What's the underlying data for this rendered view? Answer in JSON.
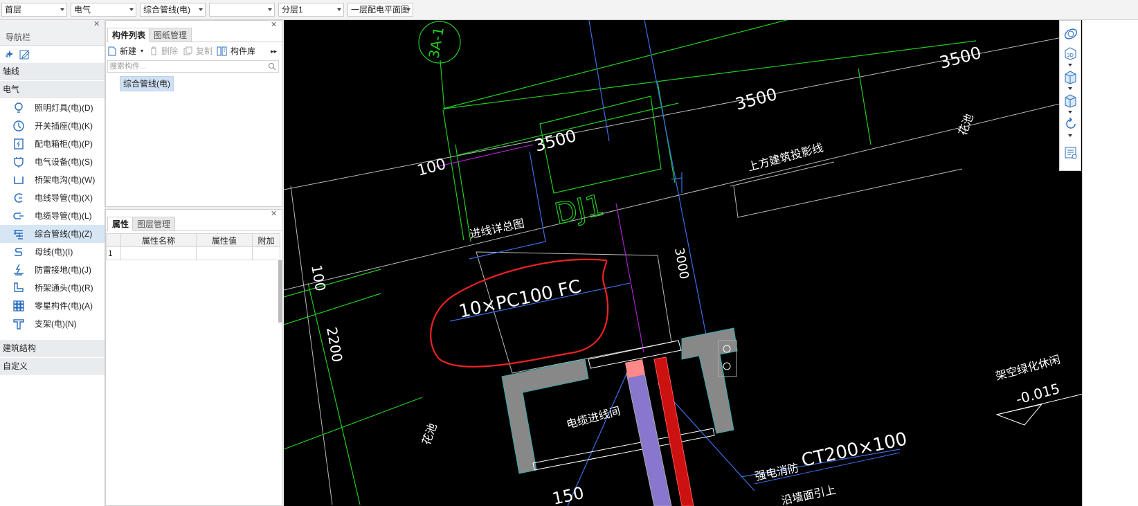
{
  "toolbar": {
    "floor": "首层",
    "discipline": "电气",
    "component_type": "综合管线(电)",
    "empty_select": "",
    "layer": "分层1",
    "drawing": "一层配电平面图"
  },
  "nav": {
    "title": "导航栏",
    "categories": {
      "axis": "轴线",
      "electric": "电气",
      "building": "建筑结构",
      "custom": "自定义"
    },
    "items": [
      {
        "label": "照明灯具(电)(D)",
        "icon": "light-bulb-icon"
      },
      {
        "label": "开关插座(电)(K)",
        "icon": "switch-socket-icon"
      },
      {
        "label": "配电箱柜(电)(P)",
        "icon": "distribution-box-icon"
      },
      {
        "label": "电气设备(电)(S)",
        "icon": "electric-equipment-icon"
      },
      {
        "label": "桥架电沟(电)(W)",
        "icon": "cable-tray-icon"
      },
      {
        "label": "电线导管(电)(X)",
        "icon": "wire-conduit-icon"
      },
      {
        "label": "电缆导管(电)(L)",
        "icon": "cable-conduit-icon"
      },
      {
        "label": "综合管线(电)(Z)",
        "icon": "combined-pipeline-icon"
      },
      {
        "label": "母线(电)(I)",
        "icon": "busbar-icon"
      },
      {
        "label": "防雷接地(电)(J)",
        "icon": "lightning-ground-icon"
      },
      {
        "label": "桥架通头(电)(R)",
        "icon": "tray-fitting-icon"
      },
      {
        "label": "零星构件(电)(A)",
        "icon": "misc-component-icon"
      },
      {
        "label": "支架(电)(N)",
        "icon": "bracket-icon"
      }
    ],
    "selected_index": 7
  },
  "complist": {
    "tabs": [
      "构件列表",
      "图纸管理"
    ],
    "tools": {
      "new": "新建",
      "delete": "删除",
      "copy": "复制",
      "library": "构件库"
    },
    "search_placeholder": "搜索构件...",
    "items": [
      "综合管线(电)"
    ]
  },
  "props": {
    "tabs": [
      "属性",
      "图层管理"
    ],
    "headers": [
      "属性名称",
      "属性值",
      "附加"
    ],
    "rows": [
      {
        "index": "1",
        "name": "",
        "value": "",
        "extra": ""
      }
    ]
  },
  "canvas": {
    "labels": {
      "axis": "3A-1",
      "dim_3500_a": "3500",
      "dim_3500_b": "3500",
      "dim_3500_c": "3500",
      "dim_100_a": "100",
      "dim_100_b": "100",
      "dim_3000": "3000",
      "dim_2200": "2200",
      "dj1": "DJ1",
      "proj_line": "上方建筑投影线",
      "flower_a": "花池",
      "flower_b": "花池",
      "entry_detail": "进线详总图",
      "pipe_spec": "10×PC100 FC",
      "cable_room": "电缆进线间",
      "strong_fire": "强电消防",
      "tray_spec": "CT200×100",
      "overhead": "架空绿化休闲",
      "elevation": "-0.015",
      "bottom_dim": "150",
      "bottom_note": "沿墙面引上"
    }
  },
  "colors": {
    "canvas_bg": "#000000",
    "selected_bg": "#d6e6f5",
    "accent": "#2a6ebb"
  }
}
